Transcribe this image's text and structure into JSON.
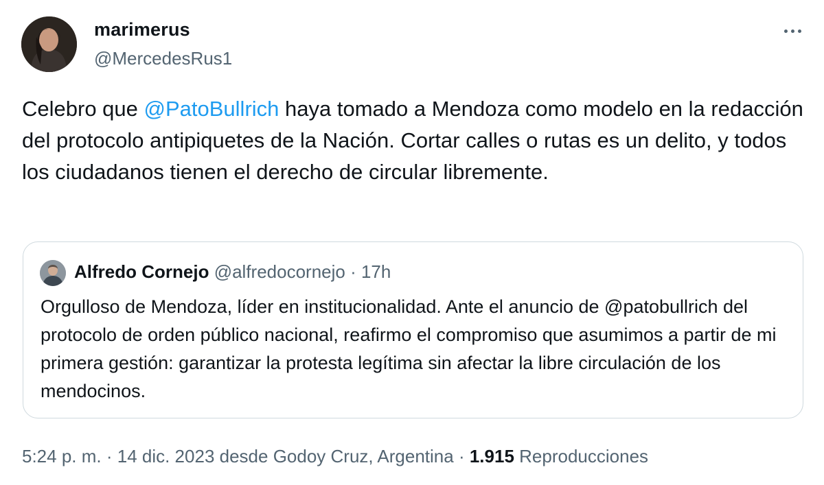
{
  "author": {
    "name": "marimerus",
    "handle": "@MercedesRus1"
  },
  "tweet": {
    "text_before": "Celebro que ",
    "mention": "@PatoBullrich",
    "text_after": " haya tomado a Mendoza como modelo en la redacción del protocolo antipiquetes de la Nación. Cortar calles o rutas es un delito, y todos los ciudadanos tienen el derecho de circular libremente."
  },
  "quote": {
    "name": "Alfredo Cornejo",
    "handle": "@alfredocornejo",
    "separator": " · ",
    "time": "17h",
    "text": "Orgulloso de Mendoza, líder en institucionalidad. Ante el anuncio de @patobullrich del protocolo de orden público nacional, reafirmo el compromiso que asumimos a partir de mi primera gestión: garantizar la protesta legítima sin afectar la libre circulación de los mendocinos."
  },
  "meta": {
    "time": "5:24 p. m.",
    "sep1": " · ",
    "date_location": "14 dic. 2023 desde Godoy Cruz, Argentina",
    "sep2": " · ",
    "views_count": "1.915",
    "views_label": " Reproducciones"
  },
  "icons": {
    "more": "more-horizontal-icon"
  },
  "colors": {
    "link": "#1d9bf0",
    "secondary_text": "#536471",
    "primary_text": "#0f1419",
    "border": "#cfd9de"
  }
}
